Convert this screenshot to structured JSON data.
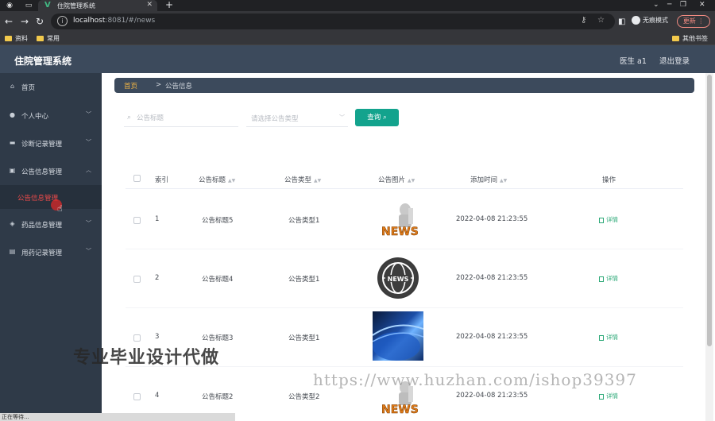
{
  "browser": {
    "tab_title": "住院管理系统",
    "url_host": "localhost",
    "url_rest": ":8081/#/news",
    "incognito_label": "无痕模式",
    "update_label": "更新",
    "bookmarks": [
      "资料",
      "常用"
    ],
    "other_bookmarks": "其他书签",
    "status_text": "正在等待..."
  },
  "app": {
    "title": "住院管理系统",
    "user_label": "医生 a1",
    "logout_label": "退出登录"
  },
  "sidebar": {
    "items": [
      {
        "label": "首页",
        "icon": "home-icon"
      },
      {
        "label": "个人中心",
        "icon": "user-icon"
      },
      {
        "label": "诊断记录管理",
        "icon": "chat-icon"
      },
      {
        "label": "公告信息管理",
        "icon": "clipboard-icon"
      },
      {
        "label": "药品信息管理",
        "icon": "shield-icon"
      },
      {
        "label": "用药记录管理",
        "icon": "notes-icon"
      }
    ],
    "sub_item": "公告信息管理"
  },
  "breadcrumb": {
    "home": "首页",
    "separator": ">",
    "current": "公告信息"
  },
  "search": {
    "title_placeholder": "公告标题",
    "type_placeholder": "请选择公告类型",
    "query_label": "查询"
  },
  "table": {
    "headers": {
      "index": "索引",
      "title": "公告标题",
      "type": "公告类型",
      "image": "公告图片",
      "time": "添加时间",
      "action": "操作"
    },
    "rows": [
      {
        "index": "1",
        "title": "公告标题5",
        "type": "公告类型1",
        "time": "2022-04-08 21:23:55",
        "action": "详情",
        "image": "news-3d-figure"
      },
      {
        "index": "2",
        "title": "公告标题4",
        "type": "公告类型1",
        "time": "2022-04-08 21:23:55",
        "action": "详情",
        "image": "news-globe-badge"
      },
      {
        "index": "3",
        "title": "公告标题3",
        "type": "公告类型1",
        "time": "2022-04-08 21:23:55",
        "action": "详情",
        "image": "blue-globe-photo"
      },
      {
        "index": "4",
        "title": "公告标题2",
        "type": "公告类型2",
        "time": "2022-04-08 21:23:55",
        "action": "详情",
        "image": "news-3d-figure"
      }
    ]
  },
  "watermarks": {
    "cn": "专业毕业设计代做",
    "url": "https://www.huzhan.com/ishop39397"
  },
  "colors": {
    "header_bg": "#3c4a5c",
    "sidebar_bg": "#2f3a48",
    "accent_green": "#13a38d",
    "active_red": "#e84a4a",
    "home_gold": "#f2b544"
  }
}
